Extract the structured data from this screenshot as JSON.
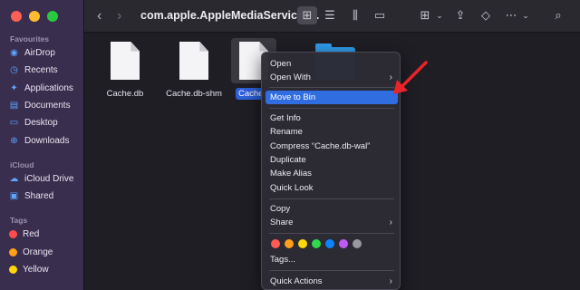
{
  "window": {
    "title": "com.apple.AppleMediaServices...",
    "back_glyph": "‹",
    "forward_glyph": "›"
  },
  "sidebar": {
    "favourites_title": "Favourites",
    "favourites": [
      {
        "label": "AirDrop",
        "icon": "airdrop-icon"
      },
      {
        "label": "Recents",
        "icon": "clock-icon"
      },
      {
        "label": "Applications",
        "icon": "applications-icon"
      },
      {
        "label": "Documents",
        "icon": "document-icon"
      },
      {
        "label": "Desktop",
        "icon": "desktop-icon"
      },
      {
        "label": "Downloads",
        "icon": "download-icon"
      }
    ],
    "icloud_title": "iCloud",
    "icloud": [
      {
        "label": "iCloud Drive",
        "icon": "cloud-icon"
      },
      {
        "label": "Shared",
        "icon": "shared-folder-icon"
      }
    ],
    "tags_title": "Tags",
    "tags": [
      {
        "label": "Red",
        "color": "#ff4b4b"
      },
      {
        "label": "Orange",
        "color": "#ff9f1a"
      },
      {
        "label": "Yellow",
        "color": "#ffd60a"
      }
    ]
  },
  "files": [
    {
      "name": "Cache.db"
    },
    {
      "name": "Cache.db-shm"
    },
    {
      "name": "Cache",
      "selected": true
    }
  ],
  "context_menu": {
    "open": "Open",
    "open_with": "Open With",
    "move_to_bin": "Move to Bin",
    "get_info": "Get Info",
    "rename": "Rename",
    "compress": "Compress “Cache.db-wal”",
    "duplicate": "Duplicate",
    "make_alias": "Make Alias",
    "quick_look": "Quick Look",
    "copy": "Copy",
    "share": "Share",
    "tags": "Tags...",
    "quick_actions": "Quick Actions",
    "chevron": "›",
    "tag_colors": [
      "#ff5a52",
      "#ff9f1a",
      "#ffd60a",
      "#32d74b",
      "#0a84ff",
      "#bf5af2",
      "#98989d"
    ]
  },
  "colors": {
    "highlight": "#2f6de0",
    "arrow": "#e8232a"
  }
}
